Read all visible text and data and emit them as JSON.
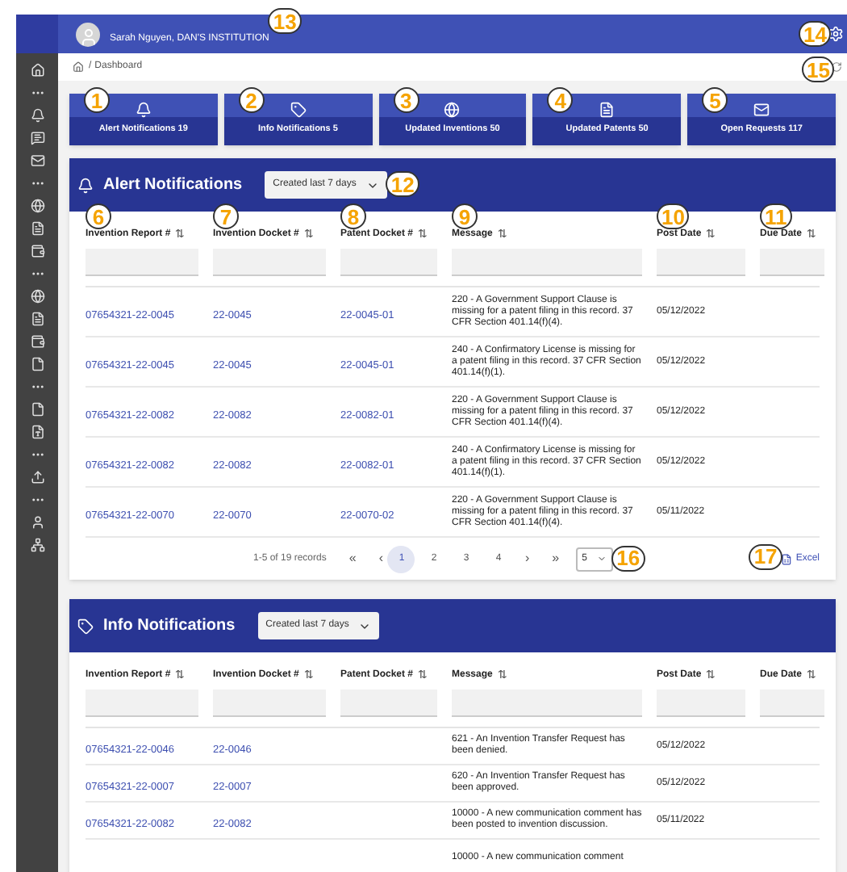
{
  "header": {
    "user": "Sarah Nguyen, DAN'S INSTITUTION",
    "callout": "13",
    "settings_callout": "14"
  },
  "breadcrumb": {
    "separator": "/",
    "current": "Dashboard",
    "refresh_callout": "15"
  },
  "cards": [
    {
      "kind": "bell",
      "label": "Alert Notifications 19",
      "callout": "1"
    },
    {
      "kind": "tag",
      "label": "Info Notifications 5",
      "callout": "2"
    },
    {
      "kind": "globe",
      "label": "Updated Inventions 50",
      "callout": "3"
    },
    {
      "kind": "doc",
      "label": "Updated Patents 50",
      "callout": "4"
    },
    {
      "kind": "mail",
      "label": "Open Requests 117",
      "callout": "5"
    }
  ],
  "alert_panel": {
    "title": "Alert Notifications",
    "filter": "Created last 7 days",
    "filter_callout": "12",
    "columns": [
      {
        "label": "Invention Report #",
        "sort": "⇅",
        "callout": "6"
      },
      {
        "label": "Invention Docket #",
        "sort": "⇅",
        "callout": "7"
      },
      {
        "label": "Patent Docket #",
        "sort": "⇅",
        "callout": "8"
      },
      {
        "label": "Message",
        "sort": "⇅",
        "callout": "9"
      },
      {
        "label": "Post Date",
        "sort": "⇅",
        "callout": "10"
      },
      {
        "label": "Due Date",
        "sort": "⇅",
        "callout": "11"
      }
    ],
    "rows": [
      {
        "report": "07654321-22-0045",
        "docket": "22-0045",
        "patent": "22-0045-01",
        "message": "220 - A Government Support Clause is missing for a patent filing in this record. 37 CFR Section 401.14(f)(4).",
        "post_date": "05/12/2022"
      },
      {
        "report": "07654321-22-0045",
        "docket": "22-0045",
        "patent": "22-0045-01",
        "message": "240 - A Confirmatory License is missing for a patent filing in this record. 37 CFR Section 401.14(f)(1).",
        "post_date": "05/12/2022"
      },
      {
        "report": "07654321-22-0082",
        "docket": "22-0082",
        "patent": "22-0082-01",
        "message": "220 - A Government Support Clause is missing for a patent filing in this record. 37 CFR Section 401.14(f)(4).",
        "post_date": "05/12/2022"
      },
      {
        "report": "07654321-22-0082",
        "docket": "22-0082",
        "patent": "22-0082-01",
        "message": "240 - A Confirmatory License is missing for a patent filing in this record. 37 CFR Section 401.14(f)(1).",
        "post_date": "05/12/2022"
      },
      {
        "report": "07654321-22-0070",
        "docket": "22-0070",
        "patent": "22-0070-02",
        "message": "220 - A Government Support Clause is missing for a patent filing in this record. 37 CFR Section 401.14(f)(4).",
        "post_date": "05/11/2022"
      }
    ],
    "pagination": {
      "summary": "1-5 of 19 records",
      "first": "«",
      "prev": "‹",
      "pages": [
        {
          "label": "1",
          "selected": true
        },
        {
          "label": "2",
          "selected": false
        },
        {
          "label": "3",
          "selected": false
        },
        {
          "label": "4",
          "selected": false
        }
      ],
      "next": "›",
      "last": "»",
      "page_size": "5",
      "page_size_callout": "16"
    },
    "export": {
      "label": "Excel",
      "callout": "17"
    }
  },
  "info_panel": {
    "title": "Info Notifications",
    "filter": "Created last 7 days",
    "columns": [
      {
        "label": "Invention Report #",
        "sort": "⇅"
      },
      {
        "label": "Invention Docket #",
        "sort": "⇅"
      },
      {
        "label": "Patent Docket #",
        "sort": "⇅"
      },
      {
        "label": "Message",
        "sort": "⇅"
      },
      {
        "label": "Post Date",
        "sort": "⇅"
      },
      {
        "label": "Due Date",
        "sort": "⇅"
      }
    ],
    "rows": [
      {
        "report": "07654321-22-0046",
        "docket": "22-0046",
        "message": "621 - An Invention Transfer Request has been denied.",
        "post_date": "05/12/2022"
      },
      {
        "report": "07654321-22-0007",
        "docket": "22-0007",
        "message": "620 - An Invention Transfer Request has been approved.",
        "post_date": "05/12/2022"
      },
      {
        "report": "07654321-22-0082",
        "docket": "22-0082",
        "message": "10000 - A new communication comment has been posted to invention discussion.",
        "post_date": "05/11/2022"
      },
      {
        "message": "10000 - A new communication comment"
      }
    ]
  }
}
